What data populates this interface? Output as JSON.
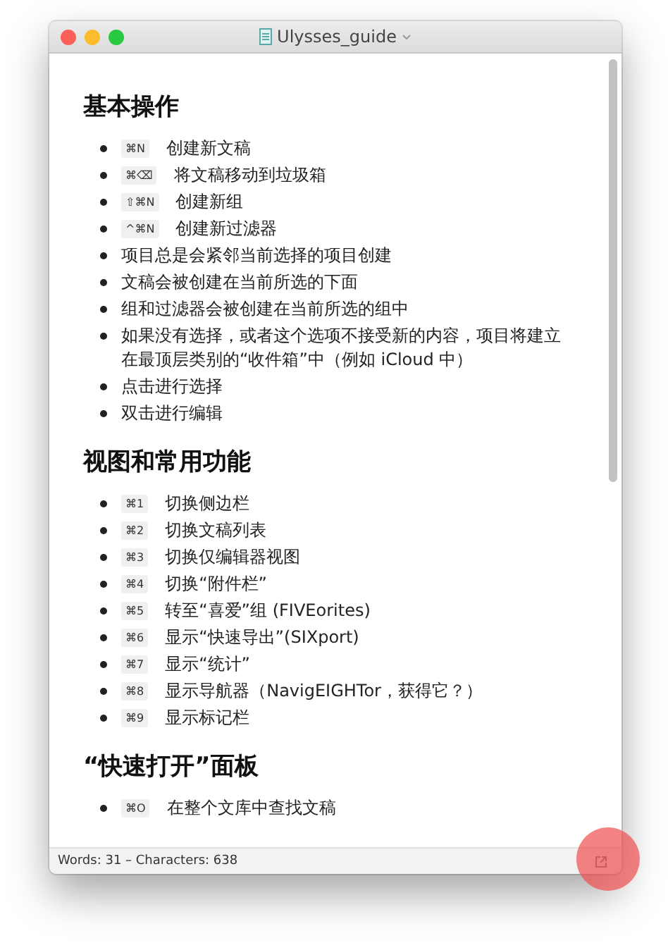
{
  "window": {
    "title": "Ulysses_guide"
  },
  "sections": [
    {
      "heading": "基本操作",
      "items": [
        {
          "shortcut": "⌘N",
          "text": "创建新文稿"
        },
        {
          "shortcut": "⌘⌫",
          "text": "将文稿移动到垃圾箱"
        },
        {
          "shortcut": "⇧⌘N",
          "text": "创建新组"
        },
        {
          "shortcut": "^⌘N",
          "text": "创建新过滤器"
        },
        {
          "text": "项目总是会紧邻当前选择的项目创建"
        },
        {
          "text": "文稿会被创建在当前所选的下面"
        },
        {
          "text": "组和过滤器会被创建在当前所选的组中"
        },
        {
          "text": "如果没有选择，或者这个选项不接受新的内容，项目将建立在最顶层类别的“收件箱”中（例如 iCloud 中）"
        },
        {
          "text": "点击进行选择"
        },
        {
          "text": "双击进行编辑"
        }
      ]
    },
    {
      "heading": "视图和常用功能",
      "items": [
        {
          "shortcut": "⌘1",
          "text": "切换侧边栏"
        },
        {
          "shortcut": "⌘2",
          "text": "切换文稿列表"
        },
        {
          "shortcut": "⌘3",
          "text": "切换仅编辑器视图"
        },
        {
          "shortcut": "⌘4",
          "text": "切换“附件栏”"
        },
        {
          "shortcut": "⌘5",
          "text": "转至“喜爱”组 (FIVEorites)"
        },
        {
          "shortcut": "⌘6",
          "text": "显示“快速导出”(SIXport)"
        },
        {
          "shortcut": "⌘7",
          "text": "显示“统计”"
        },
        {
          "shortcut": "⌘8",
          "text": "显示导航器（NavigEIGHTor，获得它？）"
        },
        {
          "shortcut": "⌘9",
          "text": "显示标记栏"
        }
      ]
    },
    {
      "heading": "“快速打开”面板",
      "items": [
        {
          "shortcut": "⌘O",
          "text": "在整个文库中查找文稿"
        }
      ]
    }
  ],
  "status_bar": {
    "text": "Words: 31 – Characters: 638"
  }
}
